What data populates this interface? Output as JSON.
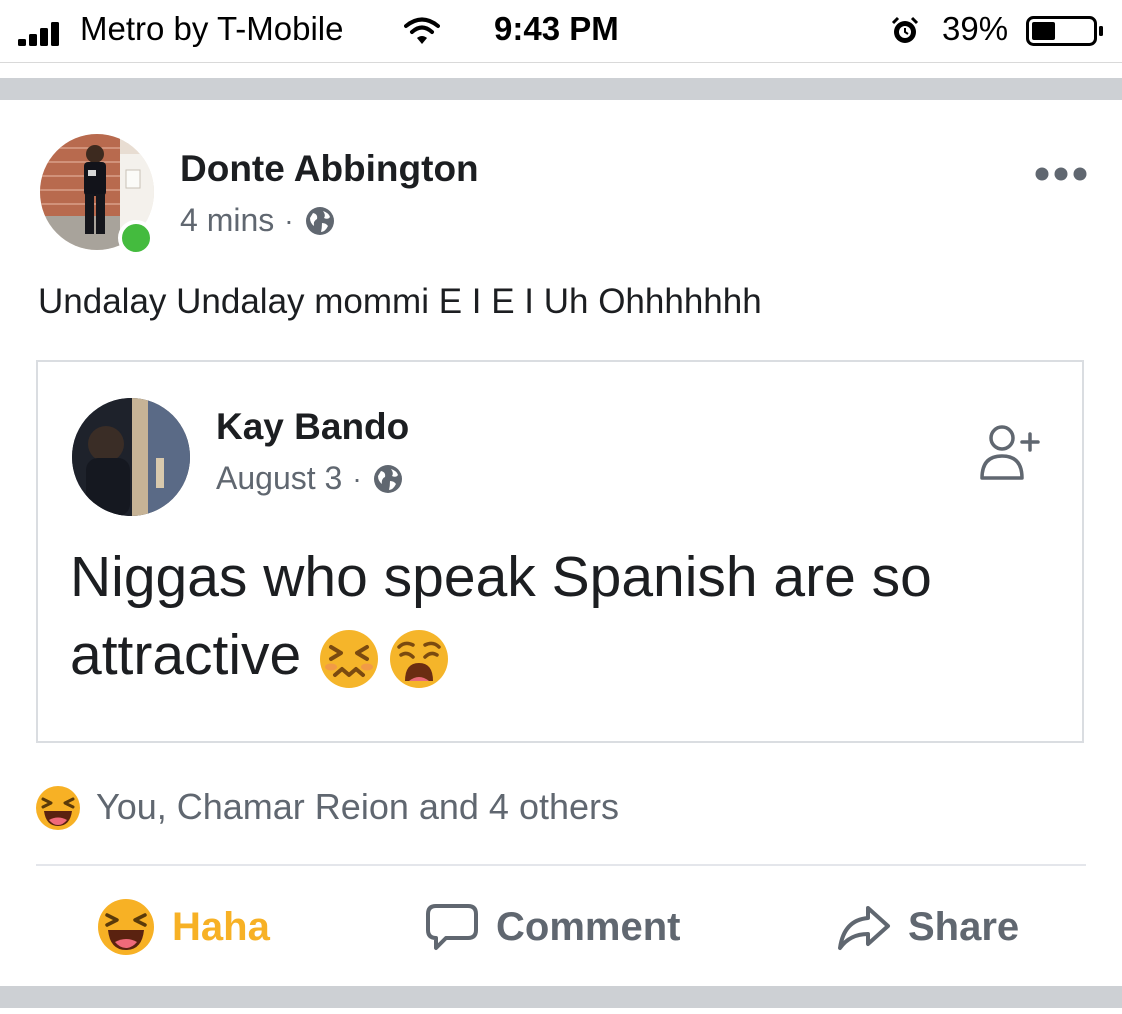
{
  "status_bar": {
    "carrier": "Metro by T-Mobile",
    "time": "9:43 PM",
    "battery_percent": "39%",
    "battery_level": 0.39,
    "icons": [
      "signal-icon",
      "wifi-icon",
      "alarm-icon",
      "battery-icon"
    ]
  },
  "post": {
    "author": "Donte Abbington",
    "timestamp": "4 mins",
    "separator": "·",
    "privacy_icon": "globe-icon",
    "online": true,
    "text": "Undalay Undalay mommi E I E I Uh Ohhhhhhh",
    "shared_post": {
      "author": "Kay Bando",
      "timestamp": "August 3",
      "separator": "·",
      "privacy_icon": "globe-icon",
      "text": "Niggas who speak Spanish are so attractive",
      "emojis": [
        "confounded-face-emoji",
        "weary-face-emoji"
      ]
    },
    "reactions": {
      "icon": "haha-reaction-icon",
      "summary": "You, Chamar Reion and 4 others"
    },
    "actions": {
      "haha": "Haha",
      "comment": "Comment",
      "share": "Share"
    }
  },
  "colors": {
    "text_primary": "#1c1e21",
    "text_secondary": "#606770",
    "haha_accent": "#f7b125",
    "online_green": "#44bb3e",
    "divider_band": "#cdd0d4"
  }
}
